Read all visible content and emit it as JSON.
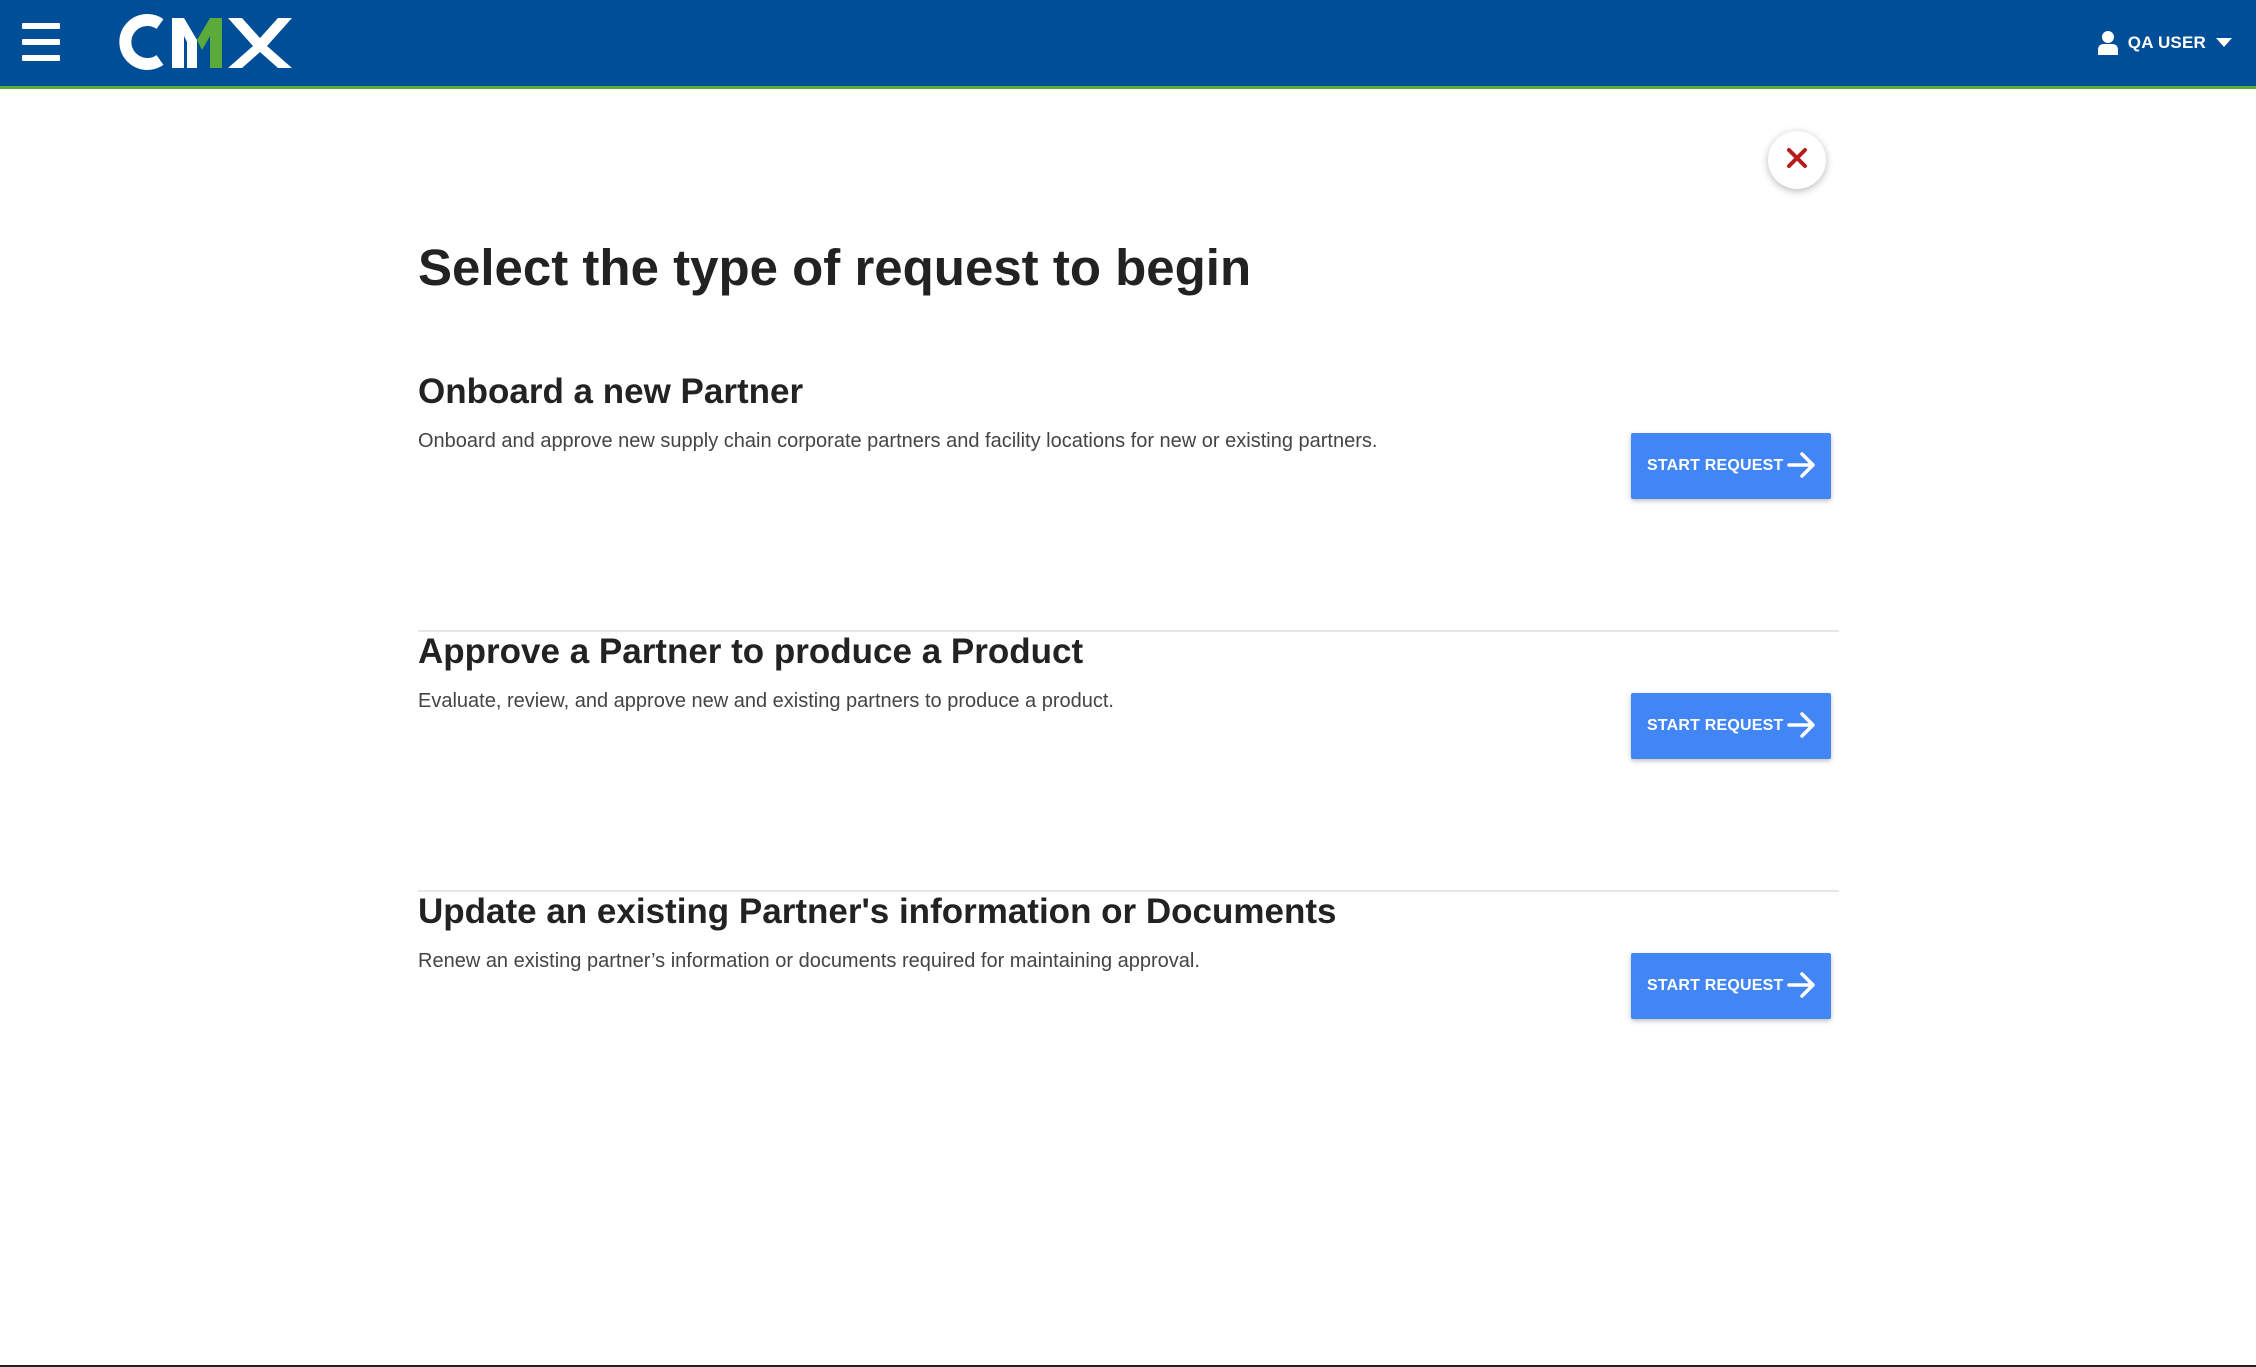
{
  "header": {
    "logo_text": "CMX",
    "user_name": "QA USER",
    "icons": {
      "menu": "hamburger-menu-icon",
      "user": "person-icon",
      "dropdown": "caret-down-icon"
    },
    "colors": {
      "bar": "#014e98",
      "accent": "#5aab3c"
    }
  },
  "main": {
    "title": "Select the type of request to begin",
    "close_icon": "close-x-icon",
    "requests": [
      {
        "heading": "Onboard a new Partner",
        "description": "Onboard and approve new supply chain corporate partners and facility locations for new or existing partners.",
        "button_label": "START REQUEST",
        "button_icon": "arrow-right-icon"
      },
      {
        "heading": "Approve a Partner to produce a Product",
        "description": "Evaluate, review, and approve new and existing partners to produce a product.",
        "button_label": "START REQUEST",
        "button_icon": "arrow-right-icon"
      },
      {
        "heading": "Update an existing Partner's information or Documents",
        "description": "Renew an existing partner’s information or documents required for maintaining approval.",
        "button_label": "START REQUEST",
        "button_icon": "arrow-right-icon"
      }
    ],
    "colors": {
      "button": "#4285f4",
      "close": "#b71c1c"
    }
  }
}
